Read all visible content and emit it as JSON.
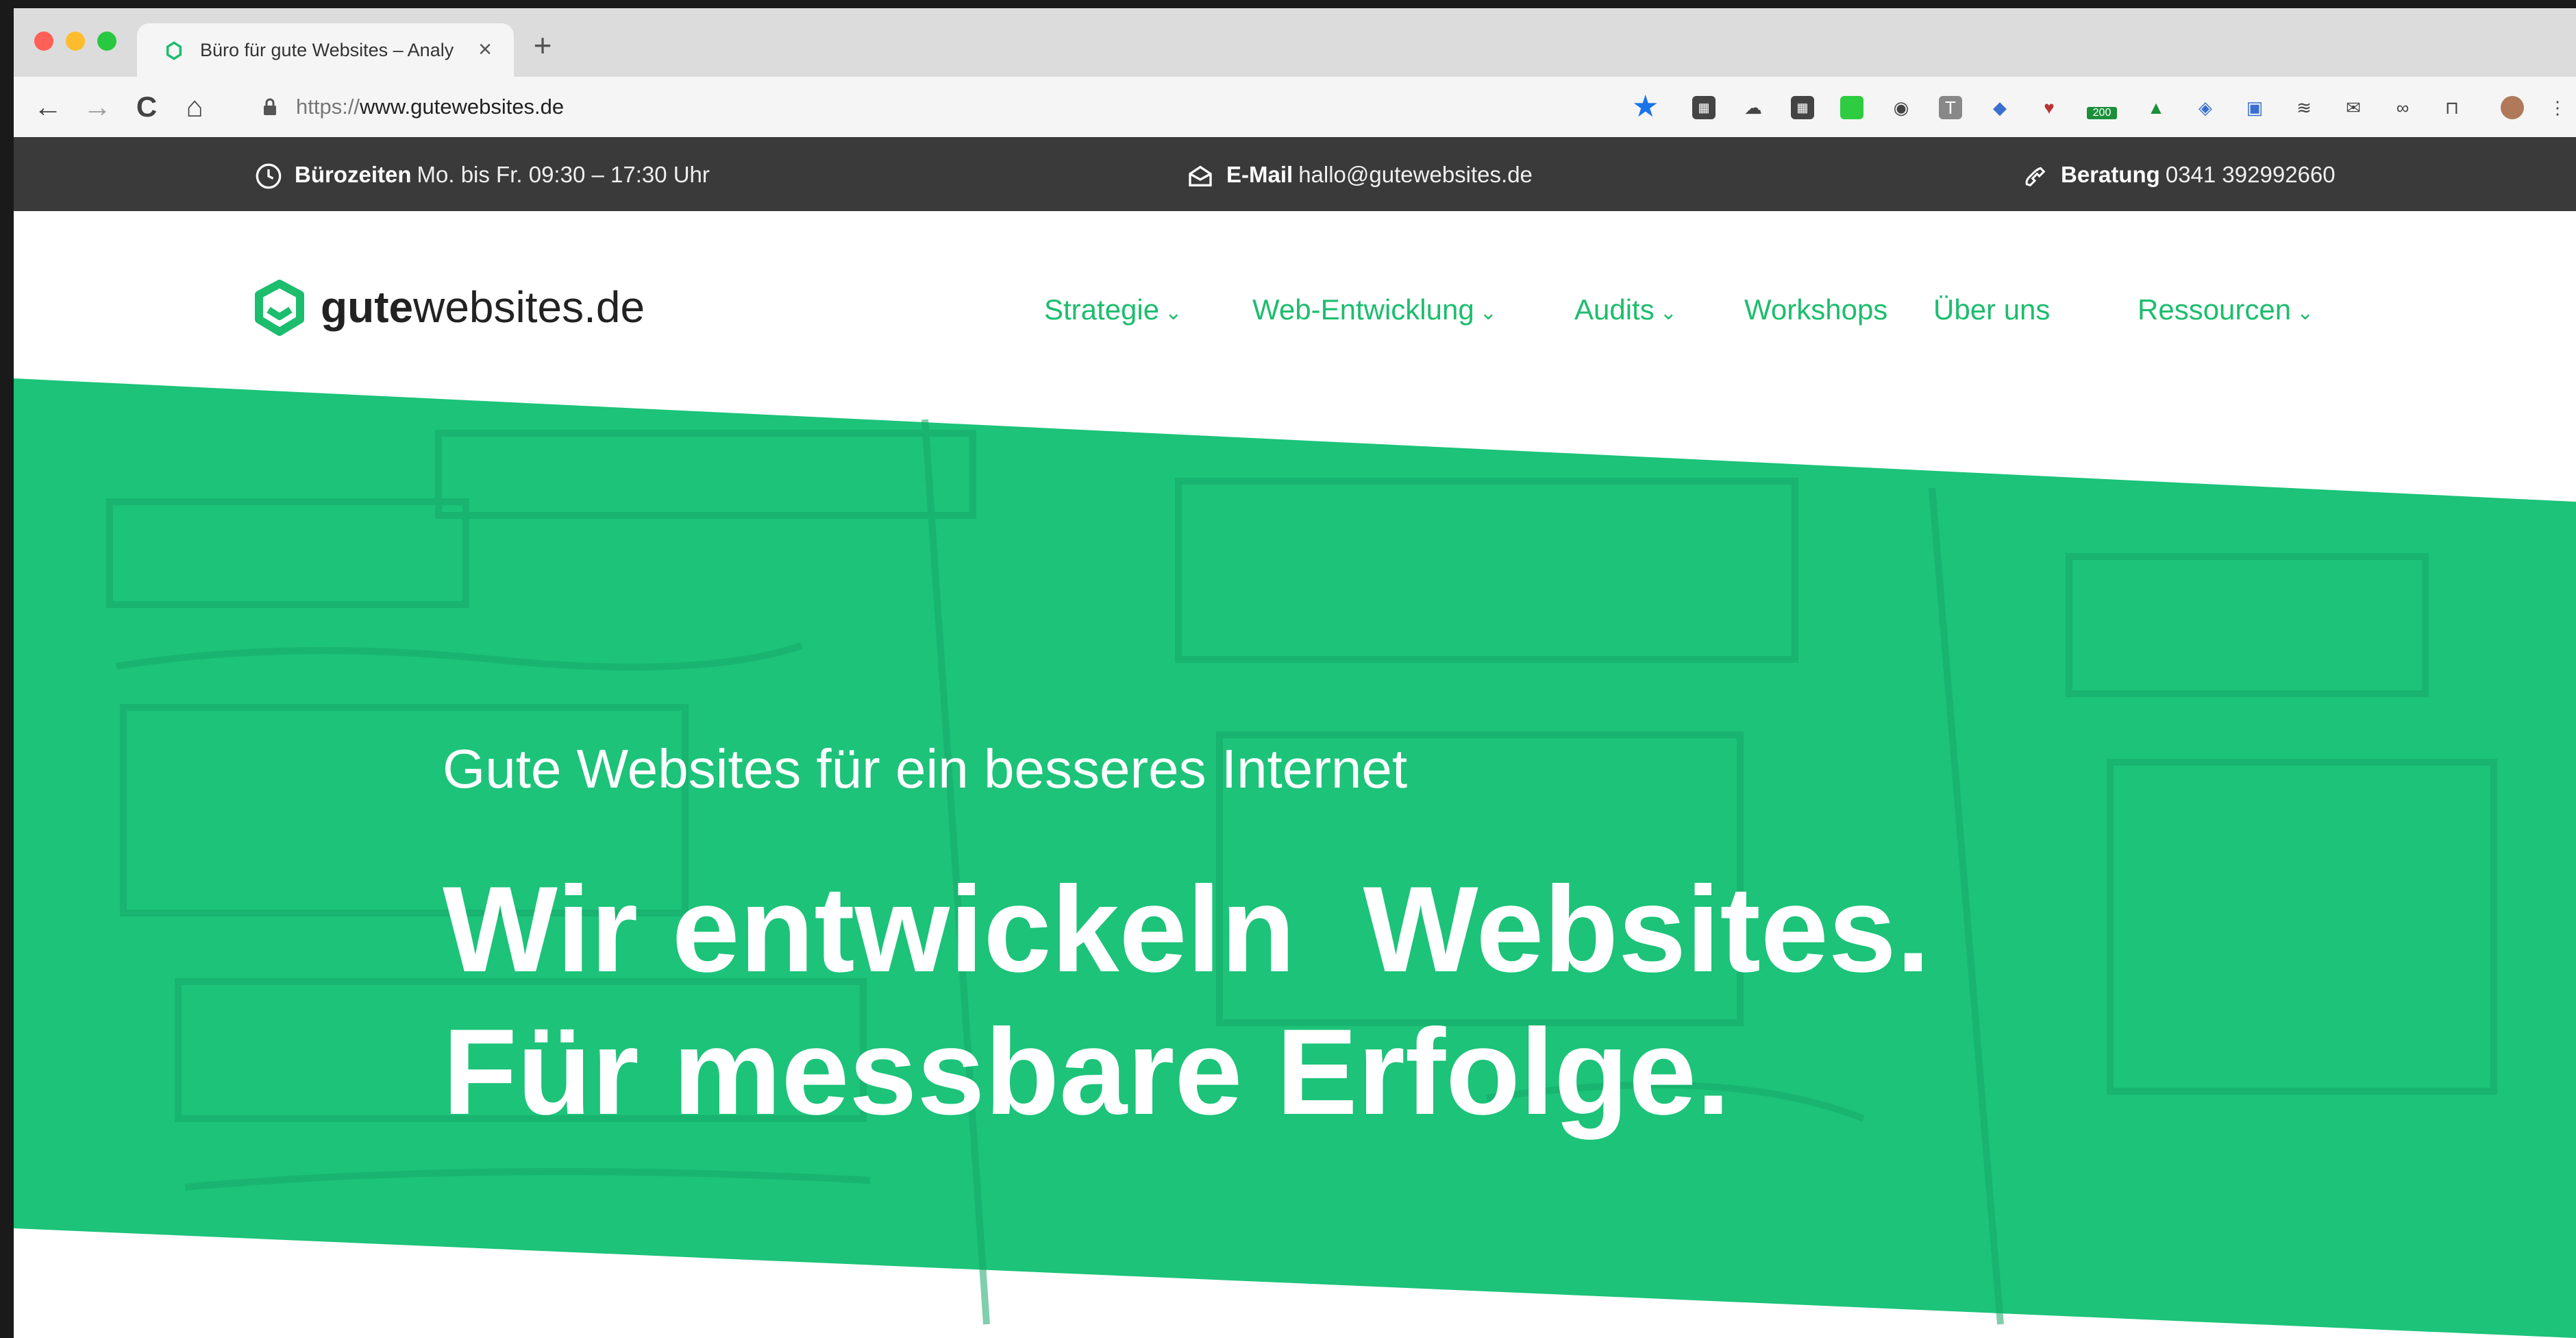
{
  "browser": {
    "tab_title": "Büro für gute Websites – Analy",
    "tab_close": "×",
    "new_tab": "+",
    "url_scheme": "https://",
    "url_host": "www.gutewebsites.de",
    "back": "←",
    "forward": "→",
    "reload": "C",
    "home": "⌂",
    "menu": "⋮",
    "extension_badge": "200"
  },
  "infobar": {
    "hours_label": "Bürozeiten",
    "hours_value": "Mo. bis Fr. 09:30 – 17:30 Uhr",
    "email_label": "E-Mail",
    "email_value": "hallo@gutewebsites.de",
    "phone_label": "Beratung",
    "phone_value": "0341 392992660"
  },
  "logo": {
    "bold": "gute",
    "rest": "websites.de"
  },
  "nav": {
    "strategie": "Strategie",
    "web": "Web-Entwicklung",
    "audits": "Audits",
    "workshops": "Workshops",
    "ueber": "Über uns",
    "ressourcen": "Ressourcen"
  },
  "hero": {
    "tagline": "Gute Websites für ein besseres Internet",
    "title_line1": "Wir entwickeln  Websites.",
    "title_line2": "Für messbare Erfolge."
  },
  "colors": {
    "brand_green": "#1dbd6e",
    "hero_green": "#1cc379",
    "infobar_bg": "#3a3a3a"
  }
}
